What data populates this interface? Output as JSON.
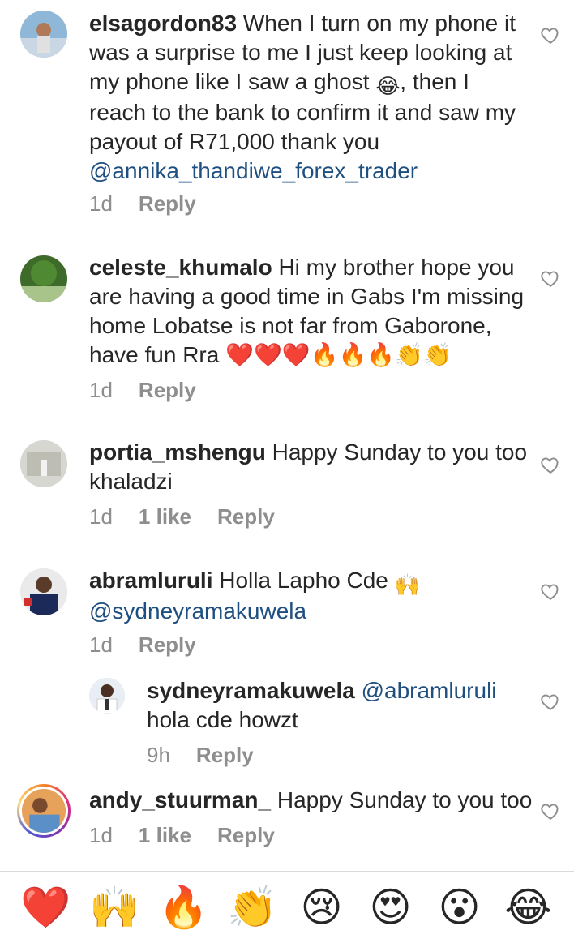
{
  "comments": [
    {
      "username": "elsagordon83",
      "text_before": "When I turn on my phone it was a surprise to me I just keep looking at my phone like I saw a ghost ",
      "emoji": "😂",
      "text_after": ", then I reach to the bank to confirm it and saw my payout of R71,000 thank you",
      "mention": "@annika_thandiwe_forex_trader",
      "time": "1d",
      "likes": "",
      "reply_label": "Reply"
    },
    {
      "username": "celeste_khumalo",
      "text": "Hi my brother hope you are having a good time in Gabs I'm missing home Lobatse is not far from Gaborone, have fun Rra ",
      "emojis": "❤️❤️❤️🔥🔥🔥👏👏",
      "time": "1d",
      "reply_label": "Reply"
    },
    {
      "username": "portia_mshengu",
      "text": "Happy Sunday to you too khaladzi",
      "time": "1d",
      "likes": "1 like",
      "reply_label": "Reply"
    },
    {
      "username": "abramluruli",
      "text": "Holla Lapho Cde ",
      "emoji": "🙌",
      "mention": "@sydneyramakuwela",
      "time": "1d",
      "reply_label": "Reply"
    },
    {
      "username": "sydneyramakuwela",
      "mention": "@abramluruli",
      "text": "hola cde howzt",
      "time": "9h",
      "reply_label": "Reply"
    },
    {
      "username": "andy_stuurman_",
      "text": "Happy Sunday to you too",
      "time": "1d",
      "likes": "1 like",
      "reply_label": "Reply"
    }
  ],
  "reactions": [
    "❤️",
    "🙌",
    "🔥",
    "👏",
    "😢",
    "😍",
    "😮",
    "😂"
  ],
  "colors": {
    "mention": "#1e4f80",
    "meta": "#8e8e8e",
    "text": "#262626"
  }
}
